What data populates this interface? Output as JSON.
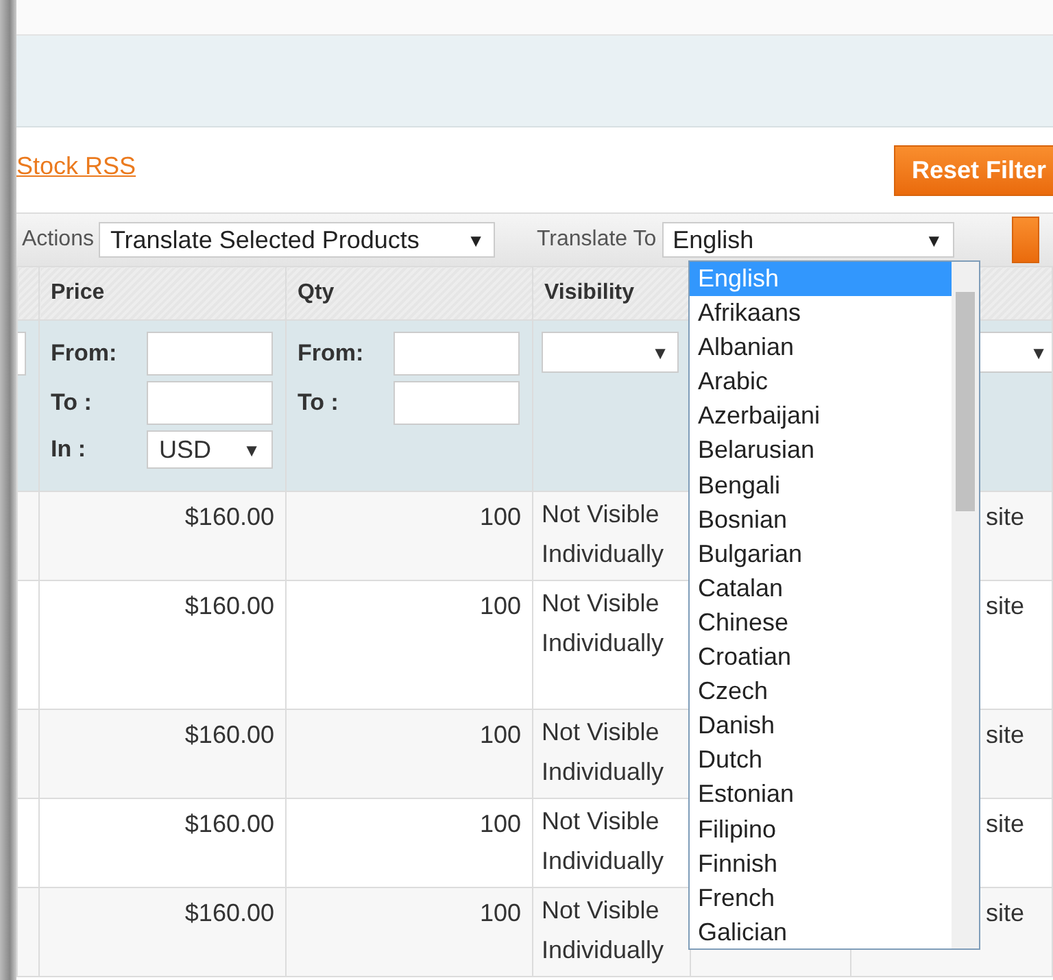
{
  "header_link": "Stock RSS",
  "reset_button": "Reset Filter",
  "actions": {
    "label": "Actions",
    "value": "Translate Selected Products",
    "arrow": "▼"
  },
  "translate_to": {
    "label": "Translate To",
    "value": "English",
    "arrow": "▼",
    "expanded": true
  },
  "columns": [
    "",
    "Price",
    "Qty",
    "Visibility",
    "",
    ""
  ],
  "price_filter": {
    "from": "From:",
    "to": "To :",
    "in": "In :",
    "currency": "USD",
    "arrow": "▼"
  },
  "qty_filter": {
    "from": "From:",
    "to": "To :"
  },
  "select_arrow": "▼",
  "rows": [
    {
      "price": "$160.00",
      "qty": "100",
      "visibility": "Not Visible Individually",
      "column_6": "site",
      "tall": false
    },
    {
      "price": "$160.00",
      "qty": "100",
      "visibility": "Not Visible Individually",
      "column_6": "site",
      "tall": true
    },
    {
      "price": "$160.00",
      "qty": "100",
      "visibility": "Not Visible Individually",
      "column_6": "site",
      "tall": false
    },
    {
      "price": "$160.00",
      "qty": "100",
      "visibility": "Not Visible Individually",
      "column_6": "site",
      "tall": false
    },
    {
      "price": "$160.00",
      "qty": "100",
      "visibility": "Not Visible Individually",
      "column_6": "site",
      "tall": false
    }
  ],
  "languages": [
    {
      "label": "English",
      "selected": true
    },
    {
      "label": "Afrikaans",
      "selected": false
    },
    {
      "label": "Albanian",
      "selected": false
    },
    {
      "label": "Arabic",
      "selected": false
    },
    {
      "label": "Azerbaijani",
      "selected": false
    },
    {
      "label": "Belarusian",
      "selected": false
    },
    {
      "label": "Bengali",
      "selected": false
    },
    {
      "label": "Bosnian",
      "selected": false
    },
    {
      "label": "Bulgarian",
      "selected": false
    },
    {
      "label": "Catalan",
      "selected": false
    },
    {
      "label": "Chinese",
      "selected": false
    },
    {
      "label": "Croatian",
      "selected": false
    },
    {
      "label": "Czech",
      "selected": false
    },
    {
      "label": "Danish",
      "selected": false
    },
    {
      "label": "Dutch",
      "selected": false
    },
    {
      "label": "Estonian",
      "selected": false
    },
    {
      "label": "Filipino",
      "selected": false
    },
    {
      "label": "Finnish",
      "selected": false
    },
    {
      "label": "French",
      "selected": false
    },
    {
      "label": "Galician",
      "selected": false
    }
  ]
}
